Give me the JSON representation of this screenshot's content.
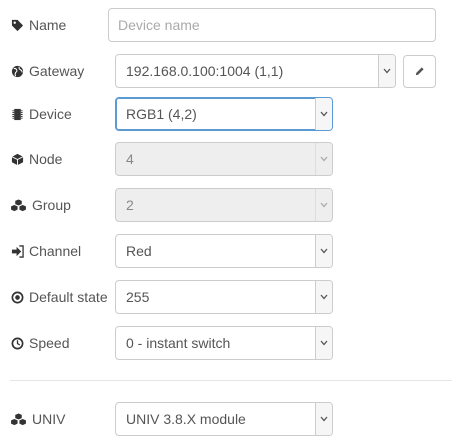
{
  "fields": {
    "name": {
      "label": "Name",
      "placeholder": "Device name",
      "value": ""
    },
    "gateway": {
      "label": "Gateway",
      "value": "192.168.0.100:1004 (1,1)"
    },
    "device": {
      "label": "Device",
      "value": "RGB1 (4,2)"
    },
    "node": {
      "label": "Node",
      "value": "4"
    },
    "group": {
      "label": "Group",
      "value": "2"
    },
    "channel": {
      "label": "Channel",
      "value": "Red"
    },
    "default_state": {
      "label": "Default state",
      "value": "255"
    },
    "speed": {
      "label": "Speed",
      "value": "0 - instant switch"
    },
    "univ": {
      "label": "UNIV",
      "value": "UNIV 3.8.X module"
    }
  },
  "icons": {
    "name": "tag-icon",
    "gateway": "globe-icon",
    "device": "chip-icon",
    "node": "cube-icon",
    "group": "cubes-icon",
    "channel": "sign-in-icon",
    "default_state": "dot-circle-icon",
    "speed": "clock-icon",
    "univ": "cubes-icon",
    "edit": "pencil-icon",
    "caret": "chevron-down-icon"
  },
  "colors": {
    "focus_border": "#5b9bd5",
    "disabled_bg": "#eeeeee",
    "border": "#cccccc",
    "text": "#555555"
  }
}
